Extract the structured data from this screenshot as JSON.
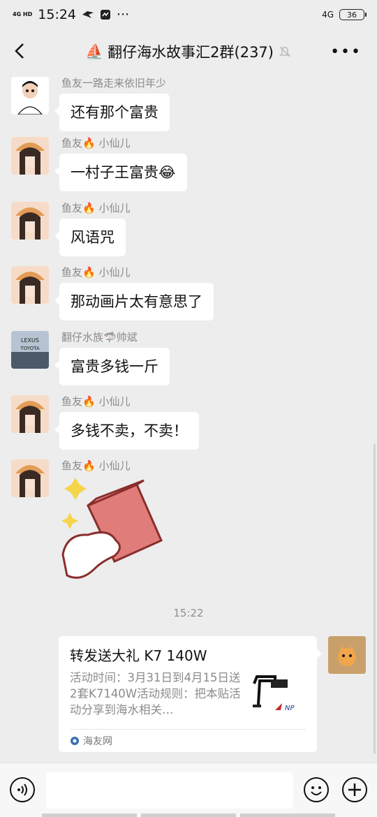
{
  "status": {
    "network": "4G HD",
    "time": "15:24",
    "right_network": "4G",
    "battery": "36"
  },
  "header": {
    "title": "翻仔海水故事汇2群(237)",
    "boat_emoji": "⛵"
  },
  "messages": [
    {
      "sender": "鱼友一路走来依旧年少",
      "text": "还有那个富贵"
    },
    {
      "sender": "鱼友🔥 小仙儿",
      "text": "一村子王富贵😂"
    },
    {
      "sender": "鱼友🔥 小仙儿",
      "text": "风语咒"
    },
    {
      "sender": "鱼友🔥 小仙儿",
      "text": "那动画片太有意思了"
    },
    {
      "sender": "翻仔水族🦈帅斌",
      "text": "富贵多钱一斤"
    },
    {
      "sender": "鱼友🔥 小仙儿",
      "text": "多钱不卖，不卖！"
    },
    {
      "sender": "鱼友🔥 小仙儿",
      "text": ""
    }
  ],
  "timestamp": "15:22",
  "card": {
    "title": "转发送大礼 K7 140W",
    "desc": "活动时间：3月31日到4月15日送2套K7140W活动规则：把本贴活动分享到海水相关…",
    "source": "海友网"
  },
  "avatar_texts": {
    "lexus": "LEXUS",
    "toyota": "TOYOTA"
  },
  "colors": {
    "background": "#ededed",
    "bubble": "#ffffff",
    "muted": "#8a8a8a"
  }
}
